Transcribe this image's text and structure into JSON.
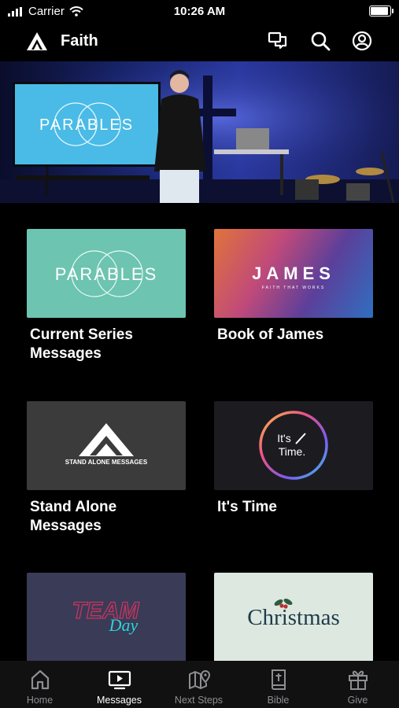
{
  "status_bar": {
    "carrier": "Carrier",
    "time": "10:26 AM",
    "battery_level": 1.0
  },
  "header": {
    "title": "Faith"
  },
  "hero": {
    "screen_text": "PARABLES"
  },
  "cards": [
    {
      "title": "Current Series Messages",
      "thumb_text": "PARABLES"
    },
    {
      "title": "Book of James",
      "thumb_text": "JAMES",
      "thumb_subtext": "FAITH THAT WORKS"
    },
    {
      "title": "Stand Alone Messages",
      "thumb_text": "STAND ALONE MESSAGES"
    },
    {
      "title": "It's Time",
      "thumb_text_1": "It's",
      "thumb_text_2": "Time."
    },
    {
      "title": "",
      "thumb_text_1": "TEAM",
      "thumb_text_2": "Day"
    },
    {
      "title": "",
      "thumb_text": "Christmas"
    }
  ],
  "tabs": [
    {
      "label": "Home",
      "icon": "home-icon"
    },
    {
      "label": "Messages",
      "icon": "tv-icon",
      "active": true
    },
    {
      "label": "Next Steps",
      "icon": "map-pin-icon"
    },
    {
      "label": "Bible",
      "icon": "bible-icon"
    },
    {
      "label": "Give",
      "icon": "gift-icon"
    }
  ],
  "colors": {
    "background": "#000000",
    "tab_bar": "#111111",
    "active": "#ffffff",
    "inactive": "#8e8e93",
    "parables_teal": "#6dc4b0"
  }
}
